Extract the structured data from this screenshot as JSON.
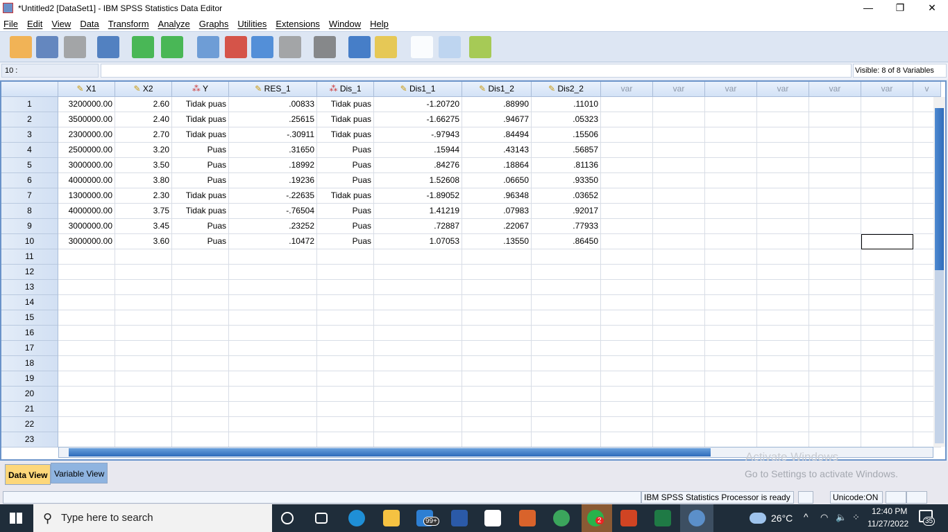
{
  "window": {
    "title": "*Untitled2 [DataSet1] - IBM SPSS Statistics Data Editor",
    "minimize": "—",
    "restore": "❐",
    "close": "✕"
  },
  "menu": [
    "File",
    "Edit",
    "View",
    "Data",
    "Transform",
    "Analyze",
    "Graphs",
    "Utilities",
    "Extensions",
    "Window",
    "Help"
  ],
  "toolbar": [
    "open-icon",
    "save-icon",
    "print-icon",
    "recall-dialog-icon",
    "undo-icon",
    "redo-icon",
    "goto-case-icon",
    "goto-variable-icon",
    "variables-icon",
    "run-descriptives-icon",
    "find-icon",
    "insert-cases-icon",
    "insert-variable-icon",
    "split-file-icon",
    "value-labels-icon",
    "use-sets-icon",
    "show-all-variables-icon"
  ],
  "cell_editor": {
    "ref": "10 :",
    "value": "",
    "visible": "Visible: 8 of 8 Variables"
  },
  "grid": {
    "columns": [
      {
        "name": "X1",
        "icon": "scale"
      },
      {
        "name": "X2",
        "icon": "scale"
      },
      {
        "name": "Y",
        "icon": "nominal"
      },
      {
        "name": "RES_1",
        "icon": "scale"
      },
      {
        "name": "Dis_1",
        "icon": "nominal"
      },
      {
        "name": "Dis1_1",
        "icon": "scale"
      },
      {
        "name": "Dis1_2",
        "icon": "scale"
      },
      {
        "name": "Dis2_2",
        "icon": "scale"
      },
      {
        "name": "var"
      },
      {
        "name": "var"
      },
      {
        "name": "var"
      },
      {
        "name": "var"
      },
      {
        "name": "var"
      },
      {
        "name": "var"
      },
      {
        "name": "v"
      }
    ],
    "rows": [
      [
        "3200000.00",
        "2.60",
        "Tidak puas",
        ".00833",
        "Tidak puas",
        "-1.20720",
        ".88990",
        ".11010"
      ],
      [
        "3500000.00",
        "2.40",
        "Tidak puas",
        ".25615",
        "Tidak puas",
        "-1.66275",
        ".94677",
        ".05323"
      ],
      [
        "2300000.00",
        "2.70",
        "Tidak puas",
        "-.30911",
        "Tidak puas",
        "-.97943",
        ".84494",
        ".15506"
      ],
      [
        "2500000.00",
        "3.20",
        "Puas",
        ".31650",
        "Puas",
        ".15944",
        ".43143",
        ".56857"
      ],
      [
        "3000000.00",
        "3.50",
        "Puas",
        ".18992",
        "Puas",
        ".84276",
        ".18864",
        ".81136"
      ],
      [
        "4000000.00",
        "3.80",
        "Puas",
        ".19236",
        "Puas",
        "1.52608",
        ".06650",
        ".93350"
      ],
      [
        "1300000.00",
        "2.30",
        "Tidak puas",
        "-.22635",
        "Tidak puas",
        "-1.89052",
        ".96348",
        ".03652"
      ],
      [
        "4000000.00",
        "3.75",
        "Tidak puas",
        "-.76504",
        "Puas",
        "1.41219",
        ".07983",
        ".92017"
      ],
      [
        "3000000.00",
        "3.45",
        "Puas",
        ".23252",
        "Puas",
        ".72887",
        ".22067",
        ".77933"
      ],
      [
        "3000000.00",
        "3.60",
        "Puas",
        ".10472",
        "Puas",
        "1.07053",
        ".13550",
        ".86450"
      ]
    ],
    "row_count": 23
  },
  "tabs": {
    "data_view": "Data View",
    "variable_view": "Variable View"
  },
  "watermark": {
    "title": "Activate Windows",
    "subtitle": "Go to Settings to activate Windows."
  },
  "status": {
    "processor": "IBM SPSS Statistics Processor is ready",
    "unicode": "Unicode:ON"
  },
  "taskbar": {
    "search_placeholder": "Type here to search",
    "weather": "26°C",
    "time": "12:40 PM",
    "date": "11/27/2022",
    "notifications": "35",
    "mail_badge": "99+",
    "whatsapp_badge": "2"
  },
  "colors": {
    "selected_tab": "#fdd77a",
    "grid_header": "#d3e2f6",
    "taskbar": "#1f2d3a"
  }
}
